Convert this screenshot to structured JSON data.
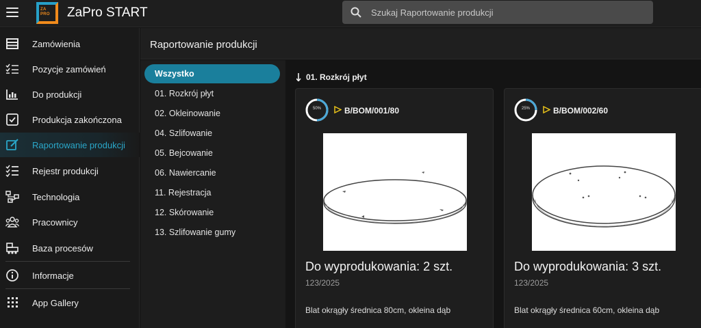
{
  "app": {
    "title": "ZaPro START",
    "logo_text": [
      "ZA",
      "PRO",
      "START"
    ]
  },
  "search": {
    "placeholder": "Szukaj Raportowanie produkcji"
  },
  "sidebar": {
    "items": [
      {
        "label": "Zamówienia",
        "icon": "orders-icon"
      },
      {
        "label": "Pozycje zamówień",
        "icon": "list-check-icon"
      },
      {
        "label": "Do produkcji",
        "icon": "factory-icon"
      },
      {
        "label": "Produkcja zakończona",
        "icon": "checkbox-icon"
      },
      {
        "label": "Raportowanie produkcji",
        "icon": "edit-report-icon",
        "active": true
      },
      {
        "label": "Rejestr produkcji",
        "icon": "checklist-icon"
      },
      {
        "label": "Technologia",
        "icon": "flow-icon"
      },
      {
        "label": "Pracownicy",
        "icon": "people-icon"
      },
      {
        "label": "Baza procesów",
        "icon": "machine-icon"
      },
      {
        "label": "Informacje",
        "icon": "info-icon"
      },
      {
        "label": "App Gallery",
        "icon": "grid-icon"
      }
    ]
  },
  "content": {
    "title": "Raportowanie produkcji"
  },
  "filters": [
    {
      "label": "Wszystko",
      "active": true
    },
    {
      "label": "01. Rozkrój płyt"
    },
    {
      "label": "02. Okleinowanie"
    },
    {
      "label": "04. Szlifowanie"
    },
    {
      "label": "05. Bejcowanie"
    },
    {
      "label": "06. Nawiercanie"
    },
    {
      "label": "11. Rejestracja"
    },
    {
      "label": "12. Skórowanie"
    },
    {
      "label": "13. Szlifowanie gumy"
    }
  ],
  "group": {
    "title": "01. Rozkrój płyt"
  },
  "cards": [
    {
      "progress_label": "50%",
      "progress": 0.5,
      "bom": "B/BOM/001/80",
      "quantity": "Do wyprodukowania: 2 szt.",
      "order": "123/2025",
      "description": "Blat okrągły średnica 80cm, okleina dąb"
    },
    {
      "progress_label": "25%",
      "progress": 0.25,
      "bom": "B/BOM/002/60",
      "quantity": "Do wyprodukowania: 3 szt.",
      "order": "123/2025",
      "description": "Blat okrągły średnica 60cm, okleina dąb"
    }
  ],
  "colors": {
    "accent": "#1a7f9c",
    "accent_text": "#2aa7c9",
    "progress": "#4aa8d8",
    "flag": "#e8c21a"
  }
}
